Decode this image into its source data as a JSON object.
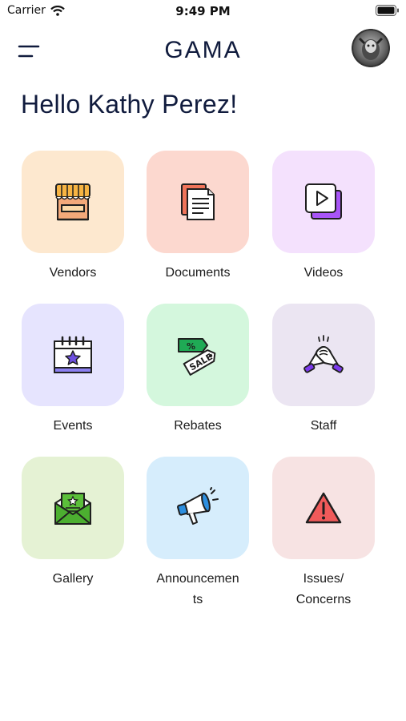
{
  "status_bar": {
    "carrier": "Carrier",
    "time": "9:49 PM"
  },
  "header": {
    "title": "GAMA"
  },
  "greeting": "Hello Kathy Perez!",
  "tiles": [
    {
      "label": "Vendors",
      "icon": "vendor-stall-icon",
      "bg": "#fde8cf"
    },
    {
      "label": "Documents",
      "icon": "documents-icon",
      "bg": "#fcd8cf"
    },
    {
      "label": "Videos",
      "icon": "video-play-icon",
      "bg": "#f4e1fd"
    },
    {
      "label": "Events",
      "icon": "calendar-star-icon",
      "bg": "#e6e4fe"
    },
    {
      "label": "Rebates",
      "icon": "sale-tag-icon",
      "bg": "#d4f7dd"
    },
    {
      "label": "Staff",
      "icon": "handshake-icon",
      "bg": "#ebe5f2"
    },
    {
      "label": "Gallery",
      "icon": "photo-envelope-icon",
      "bg": "#e5f2d4"
    },
    {
      "label": "Announcements",
      "label_lines": [
        "Announcemen",
        "ts"
      ],
      "icon": "megaphone-icon",
      "bg": "#d6edfc"
    },
    {
      "label": "Issues/ Concerns",
      "label_lines": [
        "Issues/",
        "Concerns"
      ],
      "icon": "warning-icon",
      "bg": "#f7e3e3"
    }
  ]
}
